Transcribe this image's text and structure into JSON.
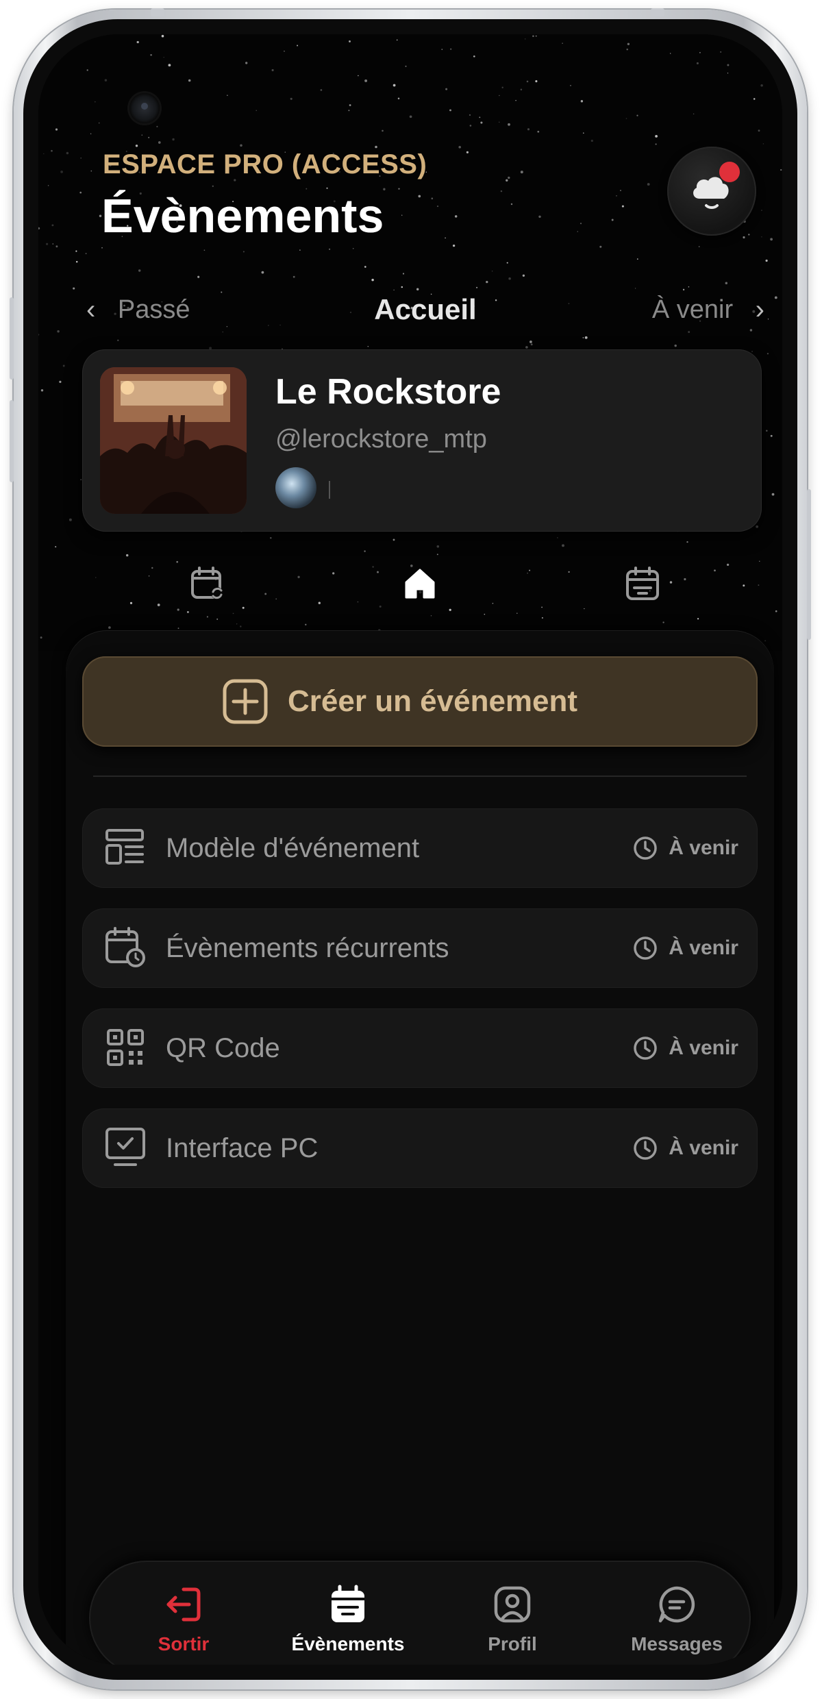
{
  "header": {
    "eyebrow": "ESPACE PRO (ACCESS)",
    "title": "Évènements",
    "notification_icon": "cloud-notification-icon"
  },
  "subnav": {
    "prev_label": "Passé",
    "current_label": "Accueil",
    "next_label": "À venir"
  },
  "venue": {
    "name": "Le Rockstore",
    "handle": "@lerockstore_mtp"
  },
  "tabs": [
    {
      "icon": "calendar-repeat-icon"
    },
    {
      "icon": "home-icon"
    },
    {
      "icon": "calendar-icon"
    }
  ],
  "create_button": {
    "label": "Créer un événement",
    "icon": "plus-square-icon"
  },
  "features": [
    {
      "label": "Modèle d'événement",
      "status": "À venir",
      "icon": "template-icon"
    },
    {
      "label": "Évènements récurrents",
      "status": "À venir",
      "icon": "calendar-clock-icon"
    },
    {
      "label": "QR Code",
      "status": "À venir",
      "icon": "qr-code-icon"
    },
    {
      "label": "Interface PC",
      "status": "À venir",
      "icon": "monitor-icon"
    }
  ],
  "bottom_nav": [
    {
      "label": "Sortir",
      "icon": "logout-icon",
      "color": "#e0303a"
    },
    {
      "label": "Évènements",
      "icon": "calendar-icon",
      "active": true,
      "color": "#ffffff"
    },
    {
      "label": "Profil",
      "icon": "profile-icon",
      "color": "#9a9a9a"
    },
    {
      "label": "Messages",
      "icon": "chat-icon",
      "color": "#9a9a9a"
    }
  ],
  "colors": {
    "accent_gold": "#d2b07c",
    "alert_red": "#e0303a",
    "background": "#050505"
  }
}
